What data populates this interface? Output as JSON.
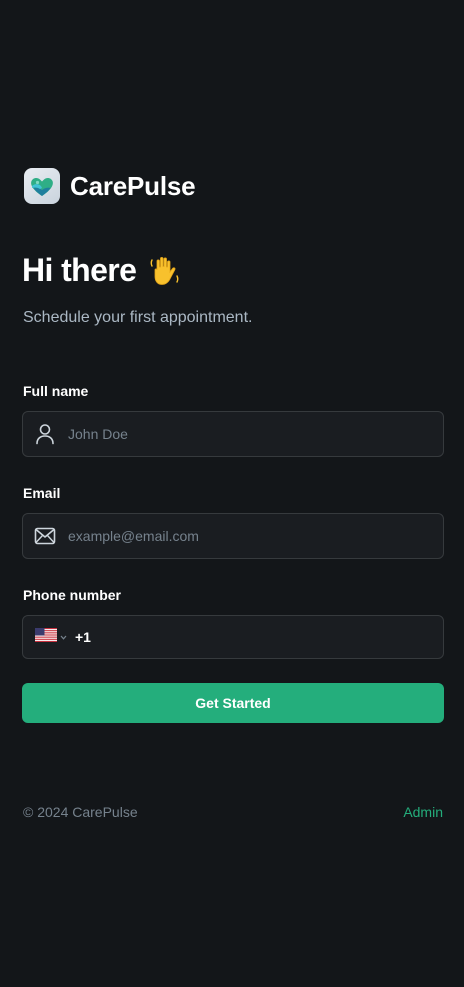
{
  "brand": {
    "name": "CarePulse",
    "logo_icon": "heart-hands-logo-icon"
  },
  "hero": {
    "title": "Hi there",
    "emoji_icon": "waving-hand-icon",
    "subtitle": "Schedule your first appointment."
  },
  "form": {
    "full_name": {
      "label": "Full name",
      "placeholder": "John Doe",
      "icon": "user-icon"
    },
    "email": {
      "label": "Email",
      "placeholder": "example@email.com",
      "icon": "mail-icon"
    },
    "phone": {
      "label": "Phone number",
      "country_icon": "us-flag-icon",
      "country_code": "+1"
    },
    "submit_label": "Get Started"
  },
  "footer": {
    "copyright": "© 2024 CarePulse",
    "admin_link": "Admin"
  },
  "colors": {
    "background": "#131619",
    "input_background": "#1a1d21",
    "input_border": "#363a3d",
    "accent": "#24ae7c",
    "muted_text": "#76828d",
    "subtitle_text": "#abb8c4"
  }
}
